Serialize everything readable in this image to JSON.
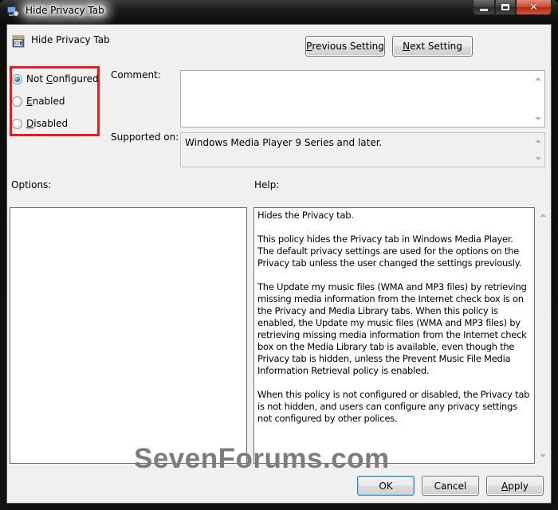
{
  "window": {
    "title": "Hide Privacy Tab",
    "icon": "policy-setting-icon",
    "caption_buttons": {
      "minimize": "minimize-icon",
      "maximize": "maximize-icon",
      "close": "close-icon"
    }
  },
  "header": {
    "title": "Hide Privacy Tab",
    "icon": "policy-setting-icon"
  },
  "nav": {
    "previous": {
      "prefix": "",
      "mnemonic": "P",
      "rest": "revious Setting"
    },
    "next": {
      "prefix": "",
      "mnemonic": "N",
      "rest": "ext Setting"
    }
  },
  "state": {
    "options": [
      {
        "prefix": "Not ",
        "mnemonic": "C",
        "rest": "onfigured",
        "checked": true
      },
      {
        "prefix": "",
        "mnemonic": "E",
        "rest": "nabled",
        "checked": false
      },
      {
        "prefix": "",
        "mnemonic": "D",
        "rest": "isabled",
        "checked": false
      }
    ],
    "highlight_color": "#e31e24"
  },
  "comment": {
    "label": "Comment:",
    "value": ""
  },
  "supported": {
    "label": "Supported on:",
    "value": "Windows Media Player 9 Series and later."
  },
  "options_panel": {
    "label": "Options:"
  },
  "help_panel": {
    "label": "Help:",
    "paragraphs": [
      "Hides the Privacy tab.",
      "This policy hides the Privacy tab in Windows Media Player. The default privacy settings are used for the options on the Privacy tab unless the user changed the settings previously.",
      "The Update my music files (WMA and MP3 files) by retrieving missing media information from the Internet check box is on the Privacy and Media Library tabs. When this policy is enabled, the Update my music files (WMA and MP3 files) by retrieving missing media information from the Internet check box on the Media Library tab is available, even though the Privacy tab is hidden, unless the Prevent Music File Media Information Retrieval policy is enabled.",
      "When this policy is not configured or disabled, the Privacy tab is not hidden, and users can configure any privacy settings not configured by other polices."
    ]
  },
  "footer": {
    "ok": "OK",
    "cancel": "Cancel",
    "apply": {
      "prefix": "",
      "mnemonic": "A",
      "rest": "pply"
    }
  },
  "watermark": "SevenForums.com"
}
